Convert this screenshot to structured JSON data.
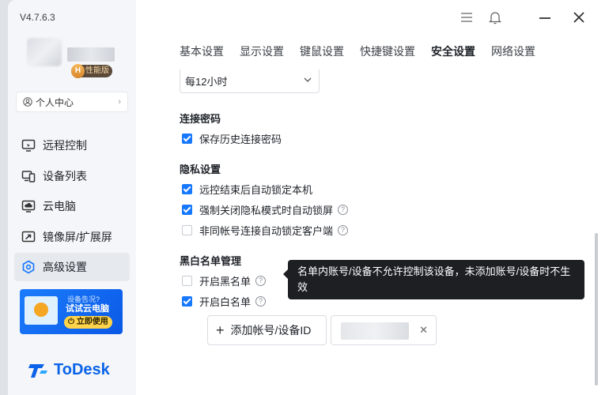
{
  "app": {
    "version": "V4.7.6.3",
    "brand": "ToDesk",
    "accent": "#1677ff"
  },
  "user": {
    "badge_letter": "H",
    "badge_text": "性能版",
    "personal_center": "个人中心"
  },
  "sidebar": {
    "items": [
      {
        "label": "远程控制",
        "icon": "remote-control-icon"
      },
      {
        "label": "设备列表",
        "icon": "device-list-icon"
      },
      {
        "label": "云电脑",
        "icon": "cloud-pc-icon"
      },
      {
        "label": "镜像屏/扩展屏",
        "icon": "mirror-screen-icon"
      },
      {
        "label": "高级设置",
        "icon": "settings-hex-icon",
        "active": true
      }
    ]
  },
  "banner": {
    "small": "设备告况?",
    "title": "试试云电脑",
    "button": "立即使用"
  },
  "tabs": [
    {
      "label": "基本设置"
    },
    {
      "label": "显示设置"
    },
    {
      "label": "键鼠设置"
    },
    {
      "label": "快捷键设置"
    },
    {
      "label": "安全设置",
      "active": true
    },
    {
      "label": "网络设置"
    }
  ],
  "lock_select": {
    "value": "每12小时"
  },
  "sections": {
    "conn_pwd": {
      "title": "连接密码",
      "save_history": "保存历史连接密码"
    },
    "privacy": {
      "title": "隐私设置",
      "lock_after_remote": "远控结束后自动锁定本机",
      "force_close_lock": "强制关闭隐私模式时自动锁屏",
      "diff_account_lock": "非同帐号连接自动锁定客户端"
    },
    "bw_list": {
      "title": "黑白名单管理",
      "blacklist": "开启黑名单",
      "whitelist": "开启白名单",
      "add_button": "添加帐号/设备ID",
      "tooltip": "名单内账号/设备不允许控制该设备，未添加账号/设备时不生效"
    }
  }
}
